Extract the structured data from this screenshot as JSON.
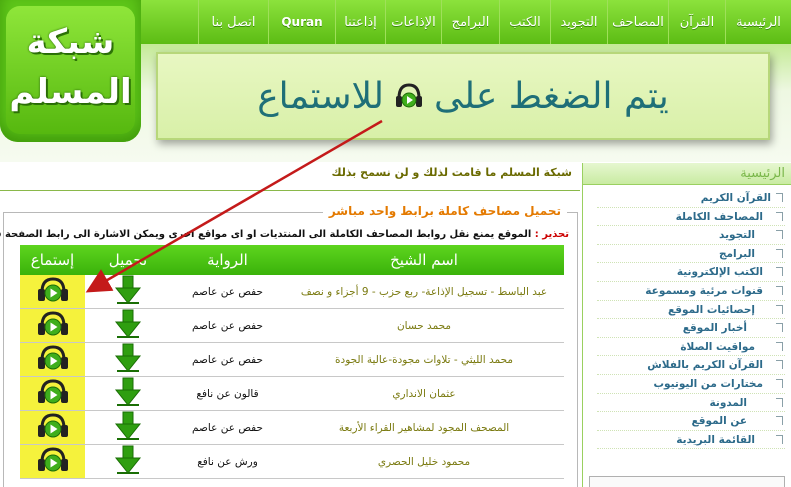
{
  "nav": {
    "items": [
      "الرئيسية",
      "القرآن",
      "المصاحف",
      "التجويد",
      "الكتب",
      "البرامج",
      "الإذاعات",
      "إذاعتنا",
      "Quran",
      "اتصل بنا"
    ]
  },
  "logo": {
    "line1": "شبكة",
    "line2": "المسلم"
  },
  "banner": {
    "text_before": "يتم الضغط على",
    "text_after": "للاستماع"
  },
  "marquee": {
    "text": "شبكة المسلم ما قامت لذلك و لن نسمح بذلك"
  },
  "sidebar": {
    "title": "الرئيسية",
    "items": [
      "القرآن الكريم",
      "المصاحف الكاملة",
      "التجويد",
      "البرامج",
      "الكتب الإلكترونية",
      "قنوات مرئية ومسموعة",
      "إحصائيات الموقع",
      "أخبار الموقع",
      "مواقيت الصلاة",
      "القرآن الكريم بالفلاش",
      "مختارات من اليوتيوب",
      "المدونة",
      "عن الموقع",
      "القائمة البريدية"
    ]
  },
  "main": {
    "legend": "تحميل مصاحف كاملة برابط واحد مباشر",
    "warning_label": "تحذير :",
    "warning_text": "الموقع يمنع نقل روابط المصاحف الكاملة الى المنتديات او اى مواقع اخرى ويمكن الاشارة الى رابط الصفحة فقط",
    "columns": [
      "اسم الشيخ",
      "الرواية",
      "تحميل",
      "إستماع"
    ],
    "rows": [
      {
        "name": "عبد الباسط - تسجيل الإذاعة- ربع حزب - 9 أجزاء و نصف",
        "narration": "حفص عن عاصم"
      },
      {
        "name": "محمد حسان",
        "narration": "حفص عن عاصم"
      },
      {
        "name": "محمد الليثي - تلاوات مجودة-عالية الجودة",
        "narration": "حفص عن عاصم"
      },
      {
        "name": "عثمان الانداري",
        "narration": "قالون عن نافع"
      },
      {
        "name": "المصحف المجود لمشاهير القراء الأربعة",
        "narration": "حفص عن عاصم"
      },
      {
        "name": "محمود خليل الحصري",
        "narration": "ورش عن نافع"
      }
    ]
  },
  "colors": {
    "brand_green": "#5cbc14",
    "banner_text": "#1f6f78",
    "legend_orange": "#e47a00",
    "listen_highlight": "#f5f23c",
    "arrow_red": "#c41a1a"
  },
  "icons": {
    "listen": "headphones-play-icon",
    "download": "green-down-arrow-icon"
  }
}
